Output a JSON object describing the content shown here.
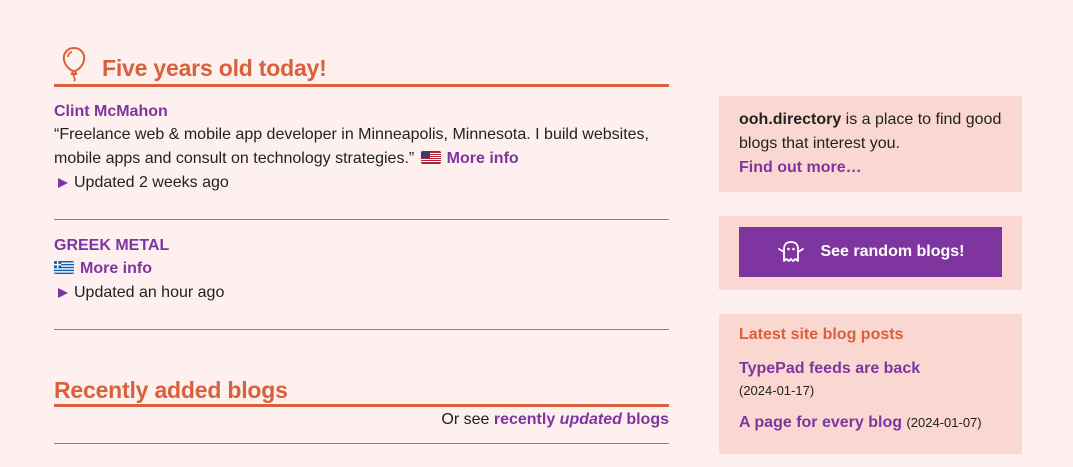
{
  "birthday": {
    "title": "Five years old today!",
    "icon": "balloon-icon",
    "blogs": [
      {
        "name": "Clint McMahon",
        "description": "“Freelance web & mobile app developer in Minneapolis, Minnesota. I build websites, mobile apps and consult on technology strategies.”",
        "flag": "us-flag-icon",
        "more_info": "More info",
        "updated": "Updated 2 weeks ago"
      },
      {
        "name": "GREEK METAL",
        "description": "",
        "flag": "greece-flag-icon",
        "more_info": "More info",
        "updated": "Updated an hour ago"
      }
    ]
  },
  "recent": {
    "title": "Recently added blogs",
    "see_prefix": "Or see ",
    "see_link_pre": "recently ",
    "see_link_em": "updated",
    "see_link_post": " blogs"
  },
  "sidebar": {
    "about": {
      "site": "ooh.directory",
      "text": " is a place to find good blogs that interest you.",
      "link": "Find out more…"
    },
    "random_button": "See random blogs!",
    "random_icon": "ghost-icon",
    "posts": {
      "title": "Latest site blog posts",
      "items": [
        {
          "title": "TypePad feeds are back",
          "date": "(2024-01-17)"
        },
        {
          "title": "A page for every blog",
          "date": "(2024-01-07)"
        }
      ]
    }
  },
  "colors": {
    "accent": "#d9603b",
    "link": "#7e35a0",
    "background": "#fdf0ef",
    "panel": "#fad8d1"
  }
}
